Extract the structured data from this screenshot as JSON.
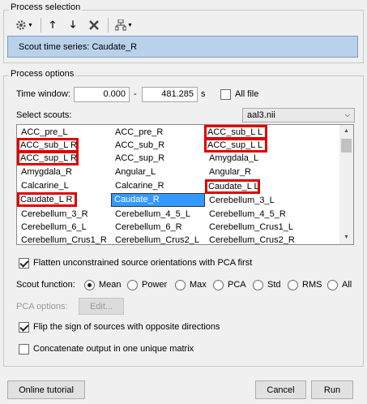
{
  "process_selection": {
    "title": "Process selection",
    "toolbar": {
      "settings_icon": "gear-icon",
      "up_icon": "arrow-up-icon",
      "down_icon": "arrow-down-icon",
      "delete_icon": "x-icon",
      "tree_icon": "tree-icon"
    },
    "selected_process": "Scout time series: Caudate_R"
  },
  "process_options": {
    "title": "Process options",
    "time_window": {
      "label": "Time window:",
      "start": "0.000",
      "dash": "-",
      "end": "481.285",
      "unit": "s",
      "all_file_label": "All file",
      "all_file_checked": false
    },
    "select_scouts": {
      "label": "Select scouts:",
      "atlas": "aal3.nii",
      "columns": [
        [
          "ACC_pre_L",
          "ACC_sub_L R",
          "ACC_sup_L R",
          "Amygdala_R",
          "Calcarine_L",
          "Caudate_L R",
          "Cerebellum_3_R",
          "Cerebellum_6_L",
          "Cerebellum_Crus1_R"
        ],
        [
          "ACC_pre_R",
          "ACC_sub_R",
          "ACC_sup_R",
          "Angular_L",
          "Calcarine_R",
          "Caudate_R",
          "Cerebellum_4_5_L",
          "Cerebellum_6_R",
          "Cerebellum_Crus2_L"
        ],
        [
          "ACC_sub_L L",
          "ACC_sup_L L",
          "Amygdala_L",
          "Angular_R",
          "Caudate_L L",
          "Cerebellum_3_L",
          "Cerebellum_4_5_R",
          "Cerebellum_Crus1_L",
          "Cerebellum_Crus2_R"
        ]
      ]
    },
    "flatten_label": "Flatten unconstrained source orientations with PCA first",
    "flatten_checked": true,
    "scout_function": {
      "label": "Scout function:",
      "options": [
        "Mean",
        "Power",
        "Max",
        "PCA",
        "Std",
        "RMS",
        "All"
      ],
      "selected": "Mean"
    },
    "pca_options_label": "PCA options:",
    "edit_label": "Edit...",
    "flip_label": "Flip the sign of sources with opposite directions",
    "flip_checked": true,
    "concat_label": "Concatenate output in one unique matrix",
    "concat_checked": false
  },
  "footer": {
    "tutorial_label": "Online tutorial",
    "cancel_label": "Cancel",
    "run_label": "Run"
  },
  "colors": {
    "highlight_border": "#e00000",
    "selection": "#3399ff",
    "process_item_bg": "#b9d1ea"
  }
}
